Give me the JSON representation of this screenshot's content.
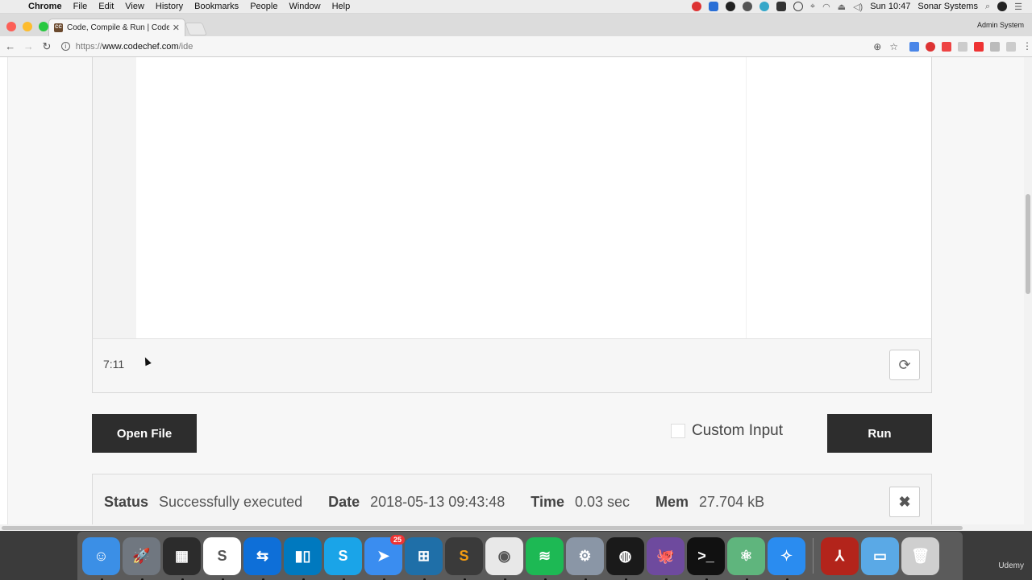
{
  "menubar": {
    "apple_glyph": "",
    "app_name": "Chrome",
    "items": [
      "File",
      "Edit",
      "View",
      "History",
      "Bookmarks",
      "People",
      "Window",
      "Help"
    ],
    "clock": "Sun 10:47",
    "user": "Sonar Systems"
  },
  "browser": {
    "tab_title": "Code, Compile & Run | CodeChef",
    "tab_favicon": "CC",
    "profile_name": "Admin System",
    "url_scheme": "https://",
    "url_host": "www.codechef.com",
    "url_path": "/ide"
  },
  "editor": {
    "cursor_position": "7:11"
  },
  "actions": {
    "open_file_label": "Open File",
    "custom_input_label": "Custom Input",
    "custom_input_checked": false,
    "run_label": "Run"
  },
  "status": {
    "status_label": "Status",
    "status_value": "Successfully executed",
    "date_label": "Date",
    "date_value": "2018-05-13 09:43:48",
    "time_label": "Time",
    "time_value": "0.03 sec",
    "mem_label": "Mem",
    "mem_value": "27.704 kB"
  },
  "dock": {
    "spark_badge": "25",
    "watermark": "Udemy",
    "apps": [
      {
        "name": "finder-icon",
        "color": "#3b8fe6"
      },
      {
        "name": "launchpad-icon",
        "color": "#707780"
      },
      {
        "name": "image-capture-icon",
        "color": "#2c2c2c"
      },
      {
        "name": "slack-icon",
        "color": "#ffffff"
      },
      {
        "name": "teamviewer-icon",
        "color": "#0e6fd8"
      },
      {
        "name": "trello-icon",
        "color": "#0079bf"
      },
      {
        "name": "skype-icon",
        "color": "#1aa4e8"
      },
      {
        "name": "spark-icon",
        "color": "#3a8df0"
      },
      {
        "name": "split-view-icon",
        "color": "#1f6fa8"
      },
      {
        "name": "sublime-text-icon",
        "color": "#3a3a3a"
      },
      {
        "name": "chrome-icon",
        "color": "#e8e8e8"
      },
      {
        "name": "spotify-icon",
        "color": "#1db954"
      },
      {
        "name": "system-preferences-icon",
        "color": "#8a96a6"
      },
      {
        "name": "obs-icon",
        "color": "#1a1a1a"
      },
      {
        "name": "github-desktop-icon",
        "color": "#6e4a9e"
      },
      {
        "name": "terminal-icon",
        "color": "#111111"
      },
      {
        "name": "atom-icon",
        "color": "#5fb57d"
      },
      {
        "name": "safari-icon",
        "color": "#2a8cf0"
      }
    ]
  }
}
